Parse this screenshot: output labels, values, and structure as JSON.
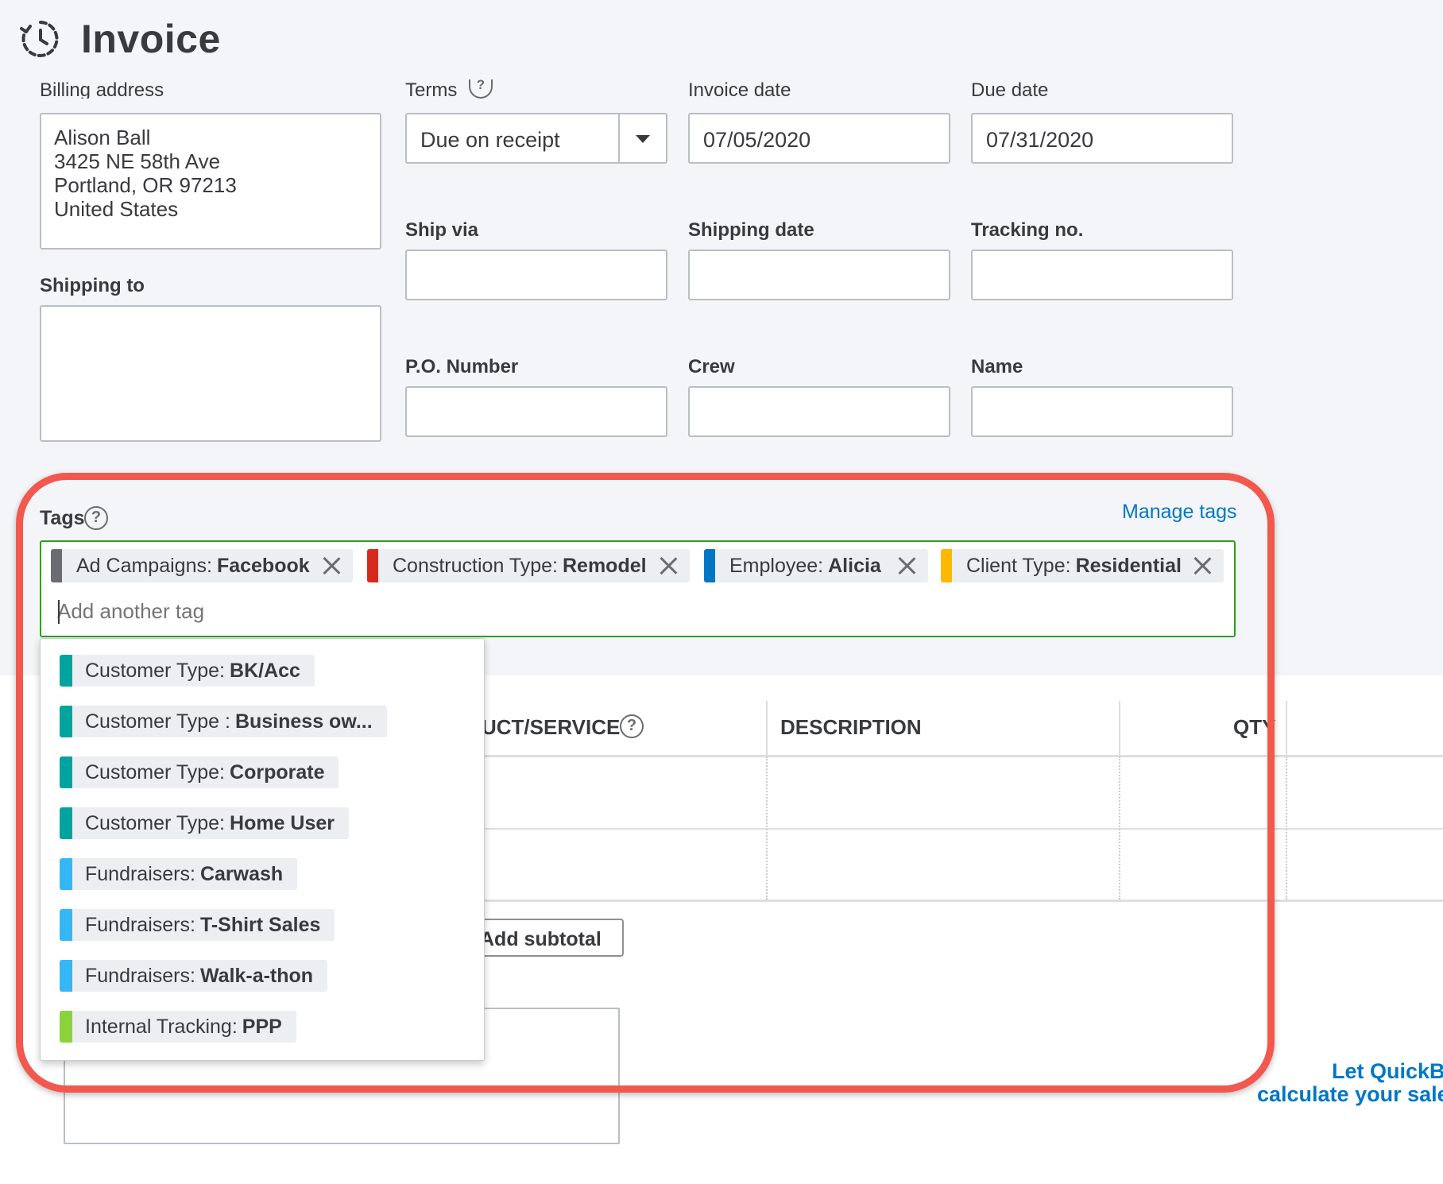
{
  "header": {
    "title": "Invoice",
    "icon": "recurring-clock-icon"
  },
  "billing": {
    "label": "Billing address",
    "lines": [
      "Alison Ball",
      "3425 NE 58th Ave",
      "Portland, OR  97213",
      "United States"
    ]
  },
  "shipping_to": {
    "label": "Shipping to"
  },
  "terms": {
    "label": "Terms",
    "value": "Due on receipt"
  },
  "invoice_date": {
    "label": "Invoice date",
    "value": "07/05/2020"
  },
  "due_date": {
    "label": "Due date",
    "value": "07/31/2020"
  },
  "ship_via": {
    "label": "Ship via"
  },
  "shipping_date": {
    "label": "Shipping date"
  },
  "tracking_no": {
    "label": "Tracking no."
  },
  "po_number": {
    "label": "P.O. Number"
  },
  "crew": {
    "label": "Crew"
  },
  "name_field": {
    "label": "Name"
  },
  "tags": {
    "label": "Tags",
    "manage_label": "Manage tags",
    "input_placeholder": "Add another tag",
    "selected": [
      {
        "group": "Ad Campaigns:",
        "value": "Facebook",
        "color": "#6b6c72"
      },
      {
        "group": "Construction Type:",
        "value": "Remodel",
        "color": "#d52b1e"
      },
      {
        "group": "Employee:",
        "value": "Alicia",
        "color": "#0077c5"
      },
      {
        "group": "Client Type:",
        "value": "Residential",
        "color": "#ffb800"
      }
    ],
    "options": [
      {
        "group": "Customer Type:",
        "value": "BK/Acc",
        "color": "#00a39e"
      },
      {
        "group": "Customer Type :",
        "value": "Business ow...",
        "color": "#00a39e"
      },
      {
        "group": "Customer Type:",
        "value": "Corporate",
        "color": "#00a39e"
      },
      {
        "group": "Customer Type:",
        "value": "Home User",
        "color": "#00a39e"
      },
      {
        "group": "Fundraisers:",
        "value": "Carwash",
        "color": "#36b7f5"
      },
      {
        "group": "Fundraisers:",
        "value": "T-Shirt Sales",
        "color": "#36b7f5"
      },
      {
        "group": "Fundraisers:",
        "value": "Walk-a-thon",
        "color": "#36b7f5"
      },
      {
        "group": "Internal Tracking:",
        "value": "PPP",
        "color": "#8bd33a"
      }
    ]
  },
  "table": {
    "col_product": "UCT/SERVICE",
    "col_description": "DESCRIPTION",
    "col_qty": "QTY"
  },
  "add_subtotal_label": "Add subtotal",
  "qb_note": {
    "line1": "Let QuickB",
    "line2": "calculate your sale"
  },
  "annotation_color": "#f2584d"
}
